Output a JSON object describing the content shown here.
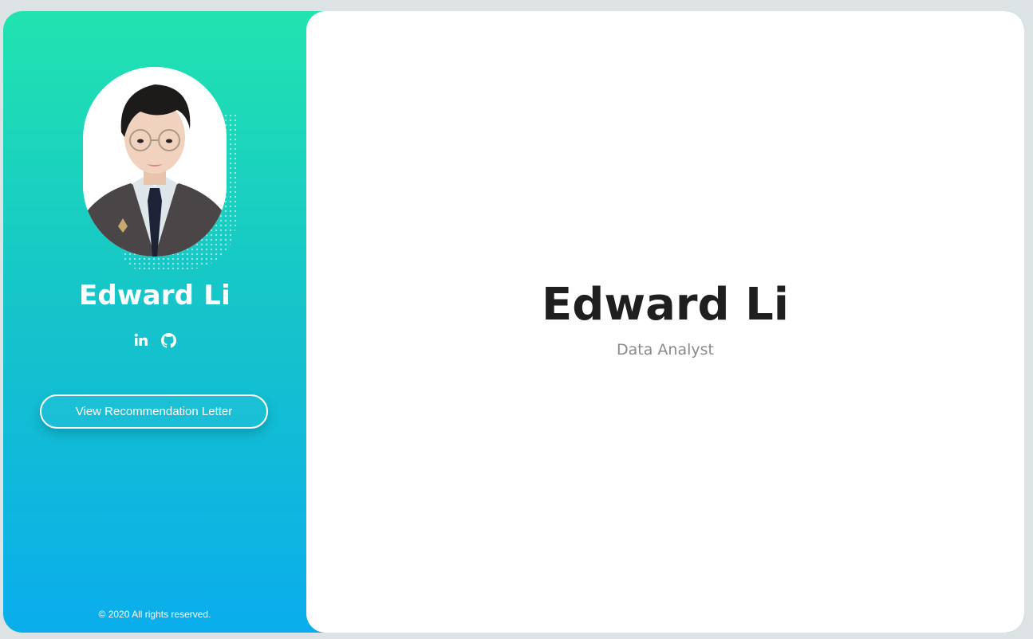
{
  "sidebar": {
    "name": "Edward Li",
    "socials": [
      {
        "icon": "linkedin-icon",
        "label": "in"
      },
      {
        "icon": "github-icon"
      }
    ],
    "recommendation_button": "View Recommendation Letter",
    "copyright": "© 2020 All rights reserved."
  },
  "main": {
    "title": "Edward Li",
    "subtitle": "Data Analyst"
  },
  "colors": {
    "gradient_top": "#21e3b0",
    "gradient_bottom": "#0aadec",
    "panel": "#ffffff",
    "title_text": "#1f1f1f",
    "subtitle_text": "#8a8a8a"
  }
}
